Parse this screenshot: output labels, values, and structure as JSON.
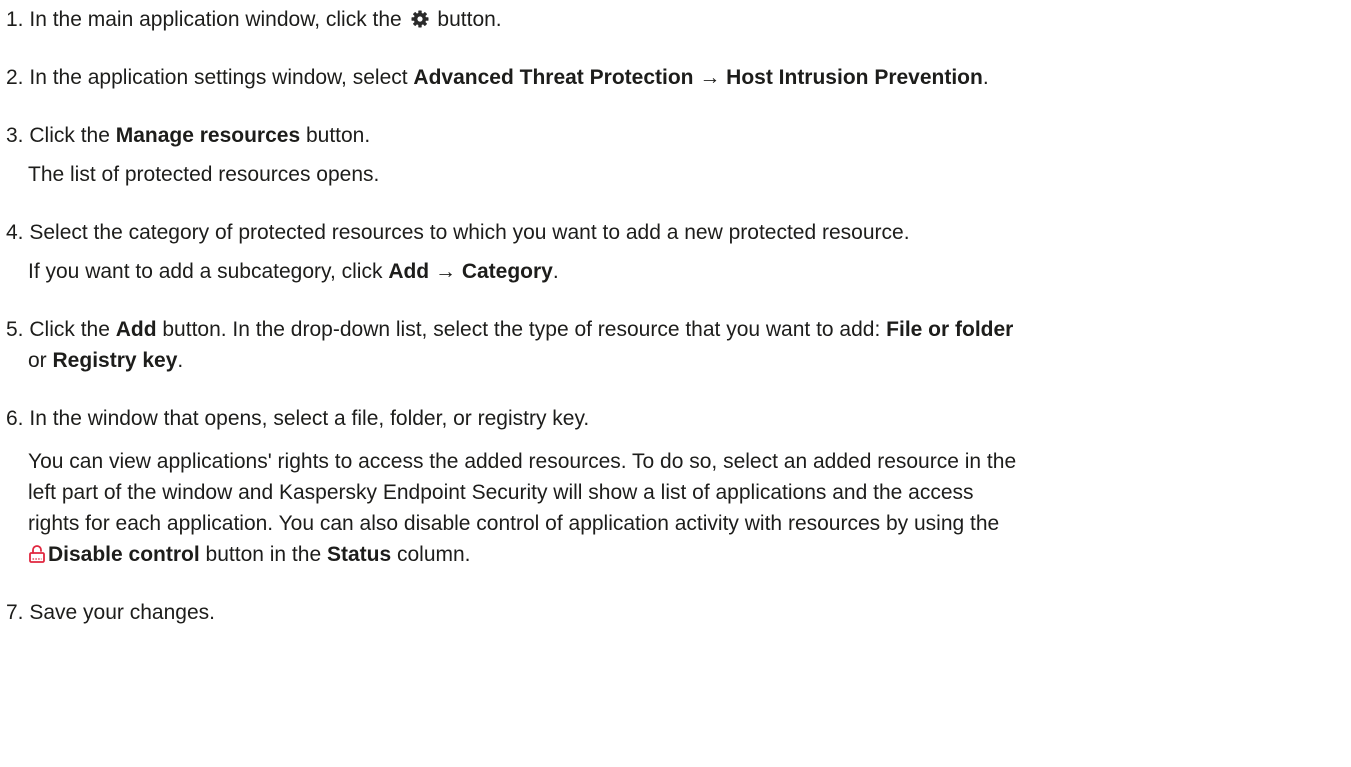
{
  "steps": [
    {
      "num": "1.",
      "parts": [
        "In the main application window, click the",
        "button."
      ],
      "icon": "gear-icon"
    },
    {
      "num": "2.",
      "pre": "In the application settings window, select ",
      "b1": "Advanced Threat Protection",
      "arrow": " → ",
      "b2": "Host Intrusion Prevention",
      "post": "."
    },
    {
      "num": "3.",
      "pre": "Click the ",
      "b1": "Manage resources",
      "post": " button.",
      "note": "The list of protected resources opens."
    },
    {
      "num": "4.",
      "text": "Select the category of protected resources to which you want to add a new protected resource.",
      "note_pre": "If you want to add a subcategory, click ",
      "note_b1": "Add",
      "note_arrow": " → ",
      "note_b2": "Category",
      "note_post": "."
    },
    {
      "num": "5.",
      "pre": "Click the ",
      "b1": "Add",
      "mid": " button. In the drop-down list, select the type of resource that you want to add: ",
      "b2": "File or folder",
      "line2_pre": "or ",
      "b3": "Registry key",
      "post": "."
    },
    {
      "num": "6.",
      "text": "In the window that opens, select a file, folder, or registry key.",
      "note1": "You can view applications' rights to access the added resources. To do so, select an added resource in the",
      "note2": "left part of the window and Kaspersky Endpoint Security will show a list of applications and the access",
      "note3": "rights for each application. You can also disable control of application activity with resources by using the",
      "note4_b1": "Disable control",
      "note4_mid": " button in the ",
      "note4_b2": "Status",
      "note4_post": " column.",
      "icon": "lock-icon"
    },
    {
      "num": "7.",
      "text": "Save your changes."
    }
  ],
  "colors": {
    "text": "#1d1d1b",
    "lock_icon": "#e0263e",
    "gear_icon": "#2b2b2b"
  }
}
